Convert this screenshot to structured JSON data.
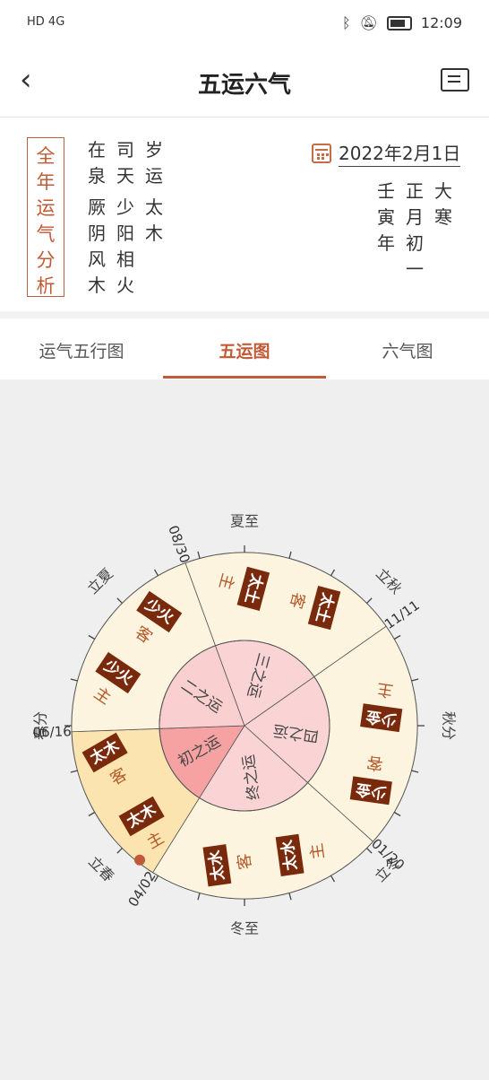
{
  "status": {
    "left_icons": "HD 4G",
    "time": "12:09"
  },
  "nav": {
    "title": "五运六气"
  },
  "info": {
    "analysis_label": [
      "全",
      "年",
      "运",
      "气",
      "分",
      "析"
    ],
    "col_suiyun": [
      "岁",
      "运",
      "",
      "太",
      "木"
    ],
    "col_sitian": [
      "司",
      "天",
      "",
      "少",
      "阳",
      "相",
      "火"
    ],
    "col_zaiquan": [
      "在",
      "泉",
      "",
      "厥",
      "阴",
      "风",
      "木"
    ],
    "date": "2022年2月1日",
    "col_dahan": [
      "大",
      "寒"
    ],
    "col_lunar": [
      "正",
      "月",
      "初",
      "一"
    ],
    "col_year": [
      "壬",
      "寅",
      "年"
    ]
  },
  "tabs": [
    "运气五行图",
    "五运图",
    "六气图"
  ],
  "wheel": {
    "outer_labels": [
      "夏至",
      "立秋",
      "秋分",
      "立冬",
      "冬至",
      "立春",
      "春分",
      "立夏"
    ],
    "dates": [
      "06/16",
      "08/30",
      "11/11",
      "01/20",
      "04/02"
    ],
    "inner": [
      "初之运",
      "二之运",
      "三之运",
      "四之运",
      "终之运"
    ],
    "sectors": [
      {
        "zhu_label": "主",
        "zhu": "太木",
        "ke_label": "客",
        "ke": "太木"
      },
      {
        "zhu_label": "主",
        "zhu": "少火",
        "ke_label": "客",
        "ke": "少火"
      },
      {
        "zhu_label": "主",
        "zhu": "太土",
        "ke_label": "客",
        "ke": "太土"
      },
      {
        "zhu_label": "主",
        "zhu": "少金",
        "ke_label": "客",
        "ke": "少金"
      },
      {
        "zhu_label": "主",
        "zhu": "太水",
        "ke_label": "客",
        "ke": "太水"
      }
    ]
  }
}
